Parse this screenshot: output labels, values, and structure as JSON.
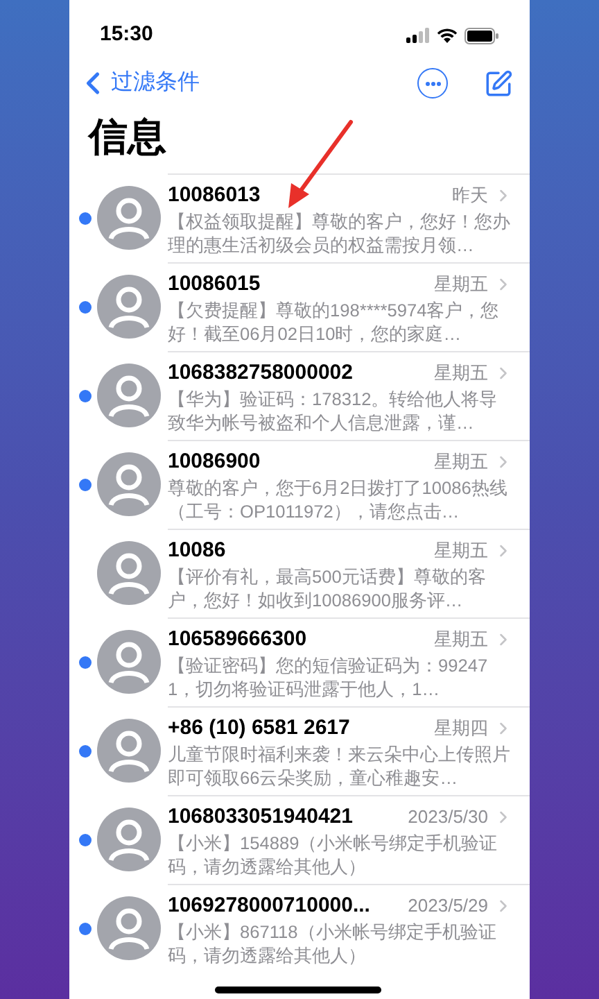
{
  "status_bar": {
    "time": "15:30"
  },
  "nav": {
    "back_label": "过滤条件"
  },
  "title": "信息",
  "messages": [
    {
      "sender": "10086013",
      "date": "昨天",
      "preview": "【权益领取提醒】尊敬的客户，您好！您办理的惠生活初级会员的权益需按月领…",
      "unread": true
    },
    {
      "sender": "10086015",
      "date": "星期五",
      "preview": "【欠费提醒】尊敬的198****5974客户，您好！截至06月02日10时，您的家庭…",
      "unread": true
    },
    {
      "sender": "1068382758000002",
      "date": "星期五",
      "preview": "【华为】验证码：178312。转给他人将导致华为帐号被盗和个人信息泄露，谨…",
      "unread": true
    },
    {
      "sender": "10086900",
      "date": "星期五",
      "preview": "尊敬的客户，您于6月2日拨打了10086热线（工号：OP1011972），请您点击…",
      "unread": true
    },
    {
      "sender": "10086",
      "date": "星期五",
      "preview": "【评价有礼，最高500元话费】尊敬的客户，您好！如收到10086900服务评…",
      "unread": false
    },
    {
      "sender": "106589666300",
      "date": "星期五",
      "preview": "【验证密码】您的短信验证码为：992471，切勿将验证码泄露于他人，1…",
      "unread": true
    },
    {
      "sender": "+86 (10) 6581 2617",
      "date": "星期四",
      "preview": "儿童节限时福利来袭！来云朵中心上传照片即可领取66云朵奖励，童心稚趣安…",
      "unread": true
    },
    {
      "sender": "1068033051940421",
      "date": "2023/5/30",
      "preview": "【小米】154889（小米帐号绑定手机验证码，请勿透露给其他人）",
      "unread": true
    },
    {
      "sender": "1069278000710000...",
      "date": "2023/5/29",
      "preview": "【小米】867118（小米帐号绑定手机验证码，请勿透露给其他人）",
      "unread": true
    }
  ]
}
